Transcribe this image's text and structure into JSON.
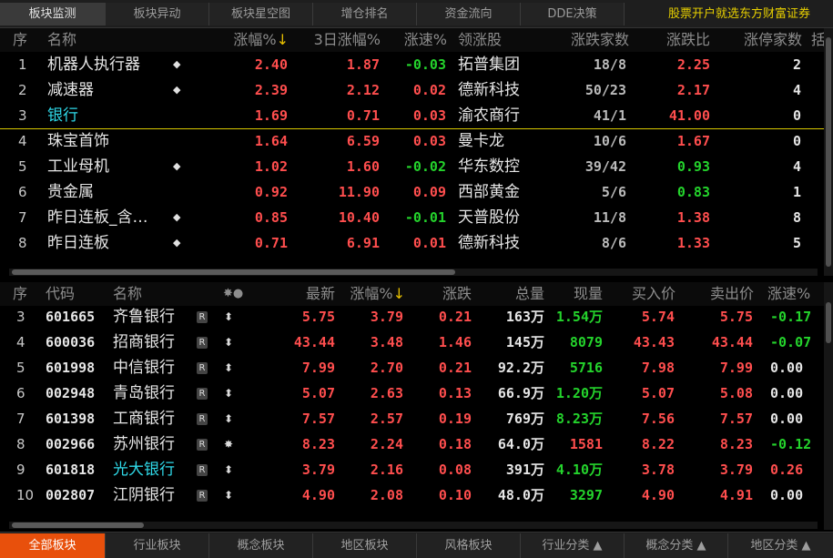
{
  "top_tabs": [
    {
      "label": "板块监测",
      "active": true
    },
    {
      "label": "板块异动",
      "active": false
    },
    {
      "label": "板块星空图",
      "active": false
    },
    {
      "label": "增仓排名",
      "active": false
    },
    {
      "label": "资金流向",
      "active": false
    },
    {
      "label": "DDE决策",
      "active": false
    }
  ],
  "ad_text": "股票开户就选东方财富证券",
  "sector_table": {
    "headers": {
      "idx": "序",
      "name": "名称",
      "chg": "涨幅%",
      "sort_arrow": "↓",
      "chg3d": "3日涨幅%",
      "speed": "涨速%",
      "leader": "领涨股",
      "updown": "涨跌家数",
      "ratio": "涨跌比",
      "limit": "涨停家数",
      "extra": "括"
    },
    "rows": [
      {
        "idx": "1",
        "name": "机器人执行器",
        "mark": "◆",
        "chg": "2.40",
        "chg3d": "1.87",
        "speed": "-0.03",
        "leader": "拓普集团",
        "updown": "18/8",
        "ratio": "2.25",
        "limit": "2",
        "name_color": "white",
        "speed_color": "green",
        "ratio_color": "red"
      },
      {
        "idx": "2",
        "name": "减速器",
        "mark": "◆",
        "chg": "2.39",
        "chg3d": "2.12",
        "speed": "0.02",
        "leader": "德新科技",
        "updown": "50/23",
        "ratio": "2.17",
        "limit": "4",
        "name_color": "white",
        "speed_color": "red",
        "ratio_color": "red"
      },
      {
        "idx": "3",
        "name": "银行",
        "mark": "",
        "chg": "1.69",
        "chg3d": "0.71",
        "speed": "0.03",
        "leader": "渝农商行",
        "updown": "41/1",
        "ratio": "41.00",
        "limit": "0",
        "name_color": "cyan",
        "speed_color": "red",
        "ratio_color": "red"
      },
      {
        "idx": "4",
        "name": "珠宝首饰",
        "mark": "",
        "chg": "1.64",
        "chg3d": "6.59",
        "speed": "0.03",
        "leader": "曼卡龙",
        "updown": "10/6",
        "ratio": "1.67",
        "limit": "0",
        "name_color": "white",
        "speed_color": "red",
        "ratio_color": "red"
      },
      {
        "idx": "5",
        "name": "工业母机",
        "mark": "◆",
        "chg": "1.02",
        "chg3d": "1.60",
        "speed": "-0.02",
        "leader": "华东数控",
        "updown": "39/42",
        "ratio": "0.93",
        "limit": "4",
        "name_color": "white",
        "speed_color": "green",
        "ratio_color": "green"
      },
      {
        "idx": "6",
        "name": "贵金属",
        "mark": "",
        "chg": "0.92",
        "chg3d": "11.90",
        "speed": "0.09",
        "leader": "西部黄金",
        "updown": "5/6",
        "ratio": "0.83",
        "limit": "1",
        "name_color": "white",
        "speed_color": "red",
        "ratio_color": "green"
      },
      {
        "idx": "7",
        "name": "昨日连板_含…",
        "mark": "◆",
        "chg": "0.85",
        "chg3d": "10.40",
        "speed": "-0.01",
        "leader": "天普股份",
        "updown": "11/8",
        "ratio": "1.38",
        "limit": "8",
        "name_color": "white",
        "speed_color": "green",
        "ratio_color": "red"
      },
      {
        "idx": "8",
        "name": "昨日连板",
        "mark": "◆",
        "chg": "0.71",
        "chg3d": "6.91",
        "speed": "0.01",
        "leader": "德新科技",
        "updown": "8/6",
        "ratio": "1.33",
        "limit": "5",
        "name_color": "white",
        "speed_color": "red",
        "ratio_color": "red"
      }
    ]
  },
  "stock_table": {
    "headers": {
      "idx": "序",
      "code": "代码",
      "name": "名称",
      "icons": "✸●",
      "last": "最新",
      "chg": "涨幅%",
      "sort_arrow": "↓",
      "change": "涨跌",
      "vol": "总量",
      "cur": "现量",
      "bid": "买入价",
      "ask": "卖出价",
      "speed": "涨速%"
    },
    "rows": [
      {
        "idx": "3",
        "code": "601665",
        "name": "齐鲁银行",
        "badge": "R",
        "icon": "⬍",
        "last": "5.75",
        "chg": "3.79",
        "change": "0.21",
        "vol": "163万",
        "cur": "1.54万",
        "bid": "5.74",
        "ask": "5.75",
        "speed": "-0.17",
        "name_color": "white",
        "cur_color": "green",
        "speed_color": "green"
      },
      {
        "idx": "4",
        "code": "600036",
        "name": "招商银行",
        "badge": "R",
        "icon": "⬍",
        "last": "43.44",
        "chg": "3.48",
        "change": "1.46",
        "vol": "145万",
        "cur": "8079",
        "bid": "43.43",
        "ask": "43.44",
        "speed": "-0.07",
        "name_color": "white",
        "cur_color": "green",
        "speed_color": "green"
      },
      {
        "idx": "5",
        "code": "601998",
        "name": "中信银行",
        "badge": "R",
        "icon": "⬍",
        "last": "7.99",
        "chg": "2.70",
        "change": "0.21",
        "vol": "92.2万",
        "cur": "5716",
        "bid": "7.98",
        "ask": "7.99",
        "speed": "0.00",
        "name_color": "white",
        "cur_color": "green",
        "speed_color": "white"
      },
      {
        "idx": "6",
        "code": "002948",
        "name": "青岛银行",
        "badge": "R",
        "icon": "⬍",
        "last": "5.07",
        "chg": "2.63",
        "change": "0.13",
        "vol": "66.9万",
        "cur": "1.20万",
        "bid": "5.07",
        "ask": "5.08",
        "speed": "0.00",
        "name_color": "white",
        "cur_color": "green",
        "speed_color": "white"
      },
      {
        "idx": "7",
        "code": "601398",
        "name": "工商银行",
        "badge": "R",
        "icon": "⬍",
        "last": "7.57",
        "chg": "2.57",
        "change": "0.19",
        "vol": "769万",
        "cur": "8.23万",
        "bid": "7.56",
        "ask": "7.57",
        "speed": "0.00",
        "name_color": "white",
        "cur_color": "green",
        "speed_color": "white"
      },
      {
        "idx": "8",
        "code": "002966",
        "name": "苏州银行",
        "badge": "R",
        "icon": "✸",
        "last": "8.23",
        "chg": "2.24",
        "change": "0.18",
        "vol": "64.0万",
        "cur": "1581",
        "bid": "8.22",
        "ask": "8.23",
        "speed": "-0.12",
        "name_color": "white",
        "cur_color": "red",
        "speed_color": "green"
      },
      {
        "idx": "9",
        "code": "601818",
        "name": "光大银行",
        "badge": "R",
        "icon": "⬍",
        "last": "3.79",
        "chg": "2.16",
        "change": "0.08",
        "vol": "391万",
        "cur": "4.10万",
        "bid": "3.78",
        "ask": "3.79",
        "speed": "0.26",
        "name_color": "cyan",
        "cur_color": "green",
        "speed_color": "red"
      },
      {
        "idx": "10",
        "code": "002807",
        "name": "江阴银行",
        "badge": "R",
        "icon": "⬍",
        "last": "4.90",
        "chg": "2.08",
        "change": "0.10",
        "vol": "48.0万",
        "cur": "3297",
        "bid": "4.90",
        "ask": "4.91",
        "speed": "0.00",
        "name_color": "white",
        "cur_color": "green",
        "speed_color": "white"
      }
    ]
  },
  "bottom_tabs": [
    {
      "label": "全部板块",
      "active": true
    },
    {
      "label": "行业板块",
      "active": false
    },
    {
      "label": "概念板块",
      "active": false
    },
    {
      "label": "地区板块",
      "active": false
    },
    {
      "label": "风格板块",
      "active": false
    },
    {
      "label": "行业分类 ▲",
      "active": false
    },
    {
      "label": "概念分类 ▲",
      "active": false
    },
    {
      "label": "地区分类 ▲",
      "active": false
    }
  ],
  "colors": {
    "red": "#ff4e4e",
    "green": "#24d32c",
    "cyan": "#2fd9e8",
    "orange_active": "#e8500c",
    "ad_yellow": "#e8d000"
  }
}
